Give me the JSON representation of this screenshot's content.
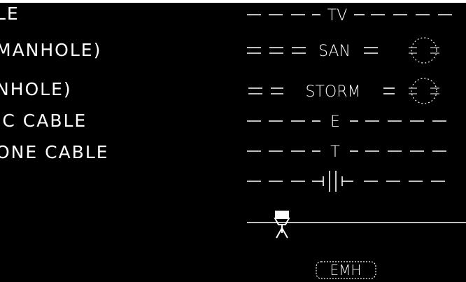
{
  "legend": {
    "rows": [
      {
        "label": "LE",
        "symbol_text": "TV",
        "symbol_type": "dashed-text"
      },
      {
        "label": "MANHOLE)",
        "symbol_text": "SAN",
        "symbol_type": "double-dashed-manhole"
      },
      {
        "label": "NHOLE)",
        "symbol_text": "STORM",
        "symbol_type": "double-dashed-manhole"
      },
      {
        "label": "IC CABLE",
        "symbol_text": "E",
        "symbol_type": "dashed-text"
      },
      {
        "label": "ONE CABLE",
        "symbol_text": "T",
        "symbol_type": "dashed-text"
      },
      {
        "label": "",
        "symbol_text": "",
        "symbol_type": "dashed-capacitor"
      }
    ],
    "footer_symbol_text": "EMH"
  },
  "colors": {
    "background": "#000000",
    "foreground": "#ffffff"
  }
}
